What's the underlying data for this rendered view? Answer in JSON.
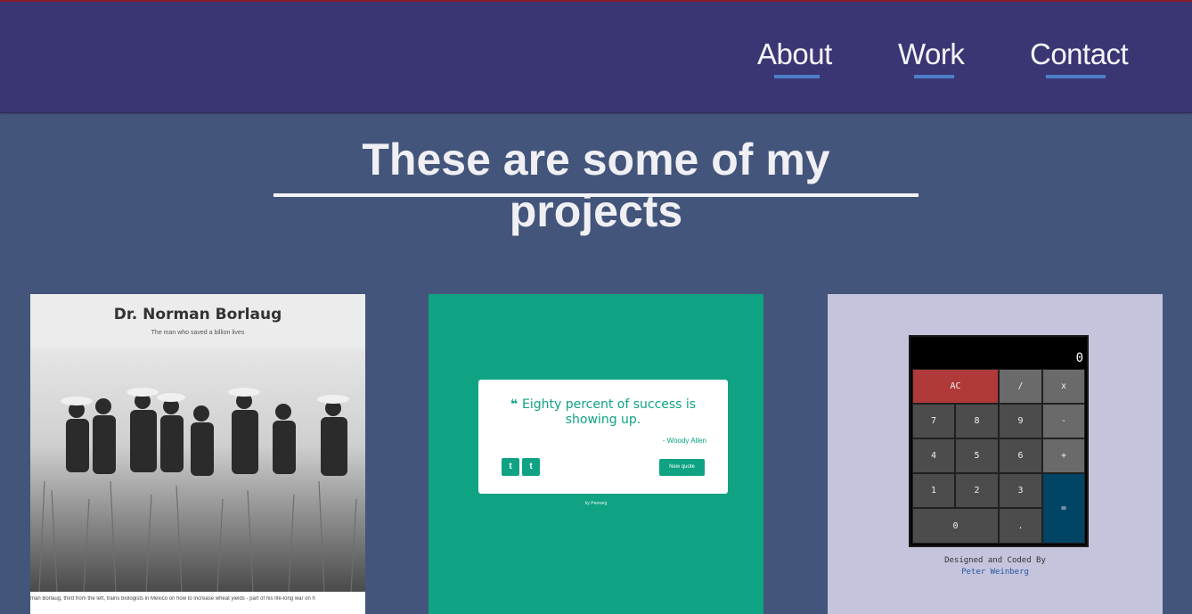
{
  "nav": {
    "about": "About",
    "work": "Work",
    "contact": "Contact",
    "underline_color": "#4d7fc8"
  },
  "heading": "These are some of my projects",
  "projects": [
    {
      "title": "Dr. Norman Borlaug",
      "subtitle": "The man who saved a billion lives",
      "caption": "man Borlaug, third from the left, trains biologists in Mexico on how to increase wheat yields - part of his life-long war on h"
    },
    {
      "quote": "Eighty percent of success is showing up.",
      "author": "- Woody Allen",
      "twitter": "t",
      "tumblr": "t",
      "button": "New quote",
      "credit": "by Peeweg"
    },
    {
      "display": "0",
      "keys": [
        "AC",
        "/",
        "x",
        "7",
        "8",
        "9",
        "-",
        "4",
        "5",
        "6",
        "+",
        "1",
        "2",
        "3",
        "=",
        "0",
        "."
      ],
      "credit": "Designed and Coded By",
      "author": "Peter Weinberg"
    }
  ]
}
